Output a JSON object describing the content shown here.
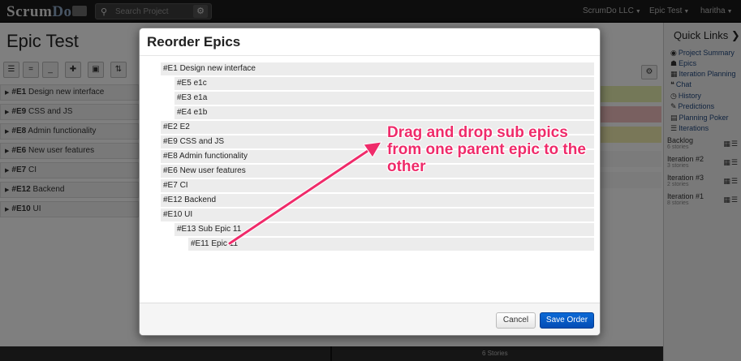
{
  "topbar": {
    "logo_a": "Scrum",
    "logo_b": "Do",
    "search_placeholder": "Search Project",
    "org_menu": "ScrumDo LLC",
    "project_menu": "Epic Test",
    "user_menu": "haritha"
  },
  "page": {
    "title": "Epic Test",
    "epics": [
      {
        "id": "#E1",
        "name": "Design new interface"
      },
      {
        "id": "#E9",
        "name": "CSS and JS"
      },
      {
        "id": "#E8",
        "name": "Admin functionality"
      },
      {
        "id": "#E6",
        "name": "New user features"
      },
      {
        "id": "#E7",
        "name": "CI"
      },
      {
        "id": "#E12",
        "name": "Backend"
      },
      {
        "id": "#E10",
        "name": "UI"
      }
    ],
    "story_count": "6 Stories"
  },
  "sidebar": {
    "title": "Quick Links",
    "links": [
      {
        "icon": "globe-icon",
        "glyph": "◉",
        "label": "Project Summary"
      },
      {
        "icon": "hierarchy-icon",
        "glyph": "☗",
        "label": "Epics"
      },
      {
        "icon": "calendar-icon",
        "glyph": "▦",
        "label": "Iteration Planning"
      },
      {
        "icon": "quote-icon",
        "glyph": "❝",
        "label": "Chat"
      },
      {
        "icon": "clock-icon",
        "glyph": "◷",
        "label": "History"
      },
      {
        "icon": "wand-icon",
        "glyph": "✎",
        "label": "Predictions"
      },
      {
        "icon": "grid-icon",
        "glyph": "▤",
        "label": "Planning Poker"
      },
      {
        "icon": "list-icon",
        "glyph": "☰",
        "label": "Iterations"
      }
    ],
    "iterations": [
      {
        "name": "Backlog",
        "count": "6 stories"
      },
      {
        "name": "Iteration #2",
        "count": "3 stories"
      },
      {
        "name": "Iteration #3",
        "count": "2 stories"
      },
      {
        "name": "Iteration #1",
        "count": "8 stories"
      }
    ]
  },
  "modal": {
    "title": "Reorder Epics",
    "items": [
      {
        "label": "#E1 Design new interface",
        "level": 0
      },
      {
        "label": "#E5 e1c",
        "level": 1
      },
      {
        "label": "#E3 e1a",
        "level": 1
      },
      {
        "label": "#E4 e1b",
        "level": 1
      },
      {
        "label": "#E2 E2",
        "level": 0
      },
      {
        "label": "#E9 CSS and JS",
        "level": 0
      },
      {
        "label": "#E8 Admin functionality",
        "level": 0
      },
      {
        "label": "#E6 New user features",
        "level": 0
      },
      {
        "label": "#E7 CI",
        "level": 0
      },
      {
        "label": "#E12 Backend",
        "level": 0
      },
      {
        "label": "#E10 UI",
        "level": 0
      },
      {
        "label": "#E13 Sub Epic 11",
        "level": 1
      },
      {
        "label": "#E11 Epic 11",
        "level": 2
      }
    ],
    "cancel_label": "Cancel",
    "save_label": "Save Order"
  },
  "annotation": {
    "text": "Drag and drop sub epics from one parent epic to the other",
    "color": "#ef2b6a"
  }
}
